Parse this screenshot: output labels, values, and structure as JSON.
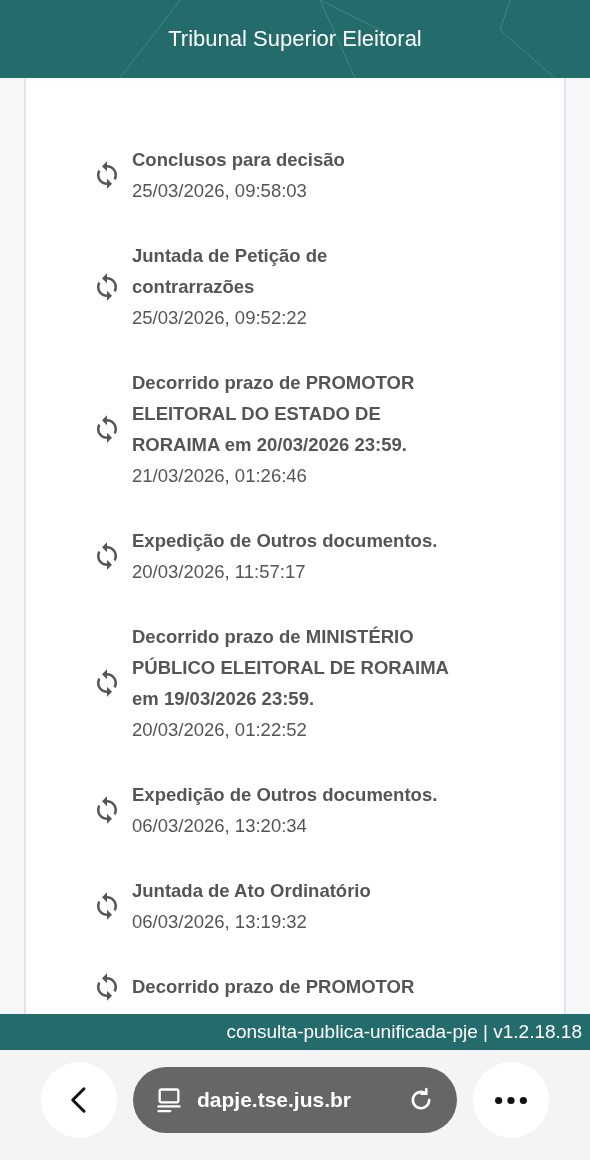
{
  "header": {
    "title": "Tribunal Superior Eleitoral"
  },
  "movements": [
    {
      "title": "Conclusos para decisão",
      "date": "25/03/2026, 09:58:03"
    },
    {
      "title": "Juntada de Petição de contrarrazões",
      "date": "25/03/2026, 09:52:22"
    },
    {
      "title": "Decorrido prazo de PROMOTOR ELEITORAL DO ESTADO DE RORAIMA em 20/03/2026 23:59.",
      "date": "21/03/2026, 01:26:46"
    },
    {
      "title": "Expedição de Outros documentos.",
      "date": "20/03/2026, 11:57:17"
    },
    {
      "title": "Decorrido prazo de MINISTÉRIO PÚBLICO ELEITORAL DE RORAIMA em 19/03/2026 23:59.",
      "date": "20/03/2026, 01:22:52"
    },
    {
      "title": "Expedição de Outros documentos.",
      "date": "06/03/2026, 13:20:34"
    },
    {
      "title": "Juntada de Ato Ordinatório",
      "date": "06/03/2026, 13:19:32"
    },
    {
      "title": "Decorrido prazo de PROMOTOR"
    }
  ],
  "footer": {
    "version": "consulta-publica-unificada-pje | v1.2.18.18"
  },
  "browser": {
    "url": "dapje.tse.jus.br"
  }
}
